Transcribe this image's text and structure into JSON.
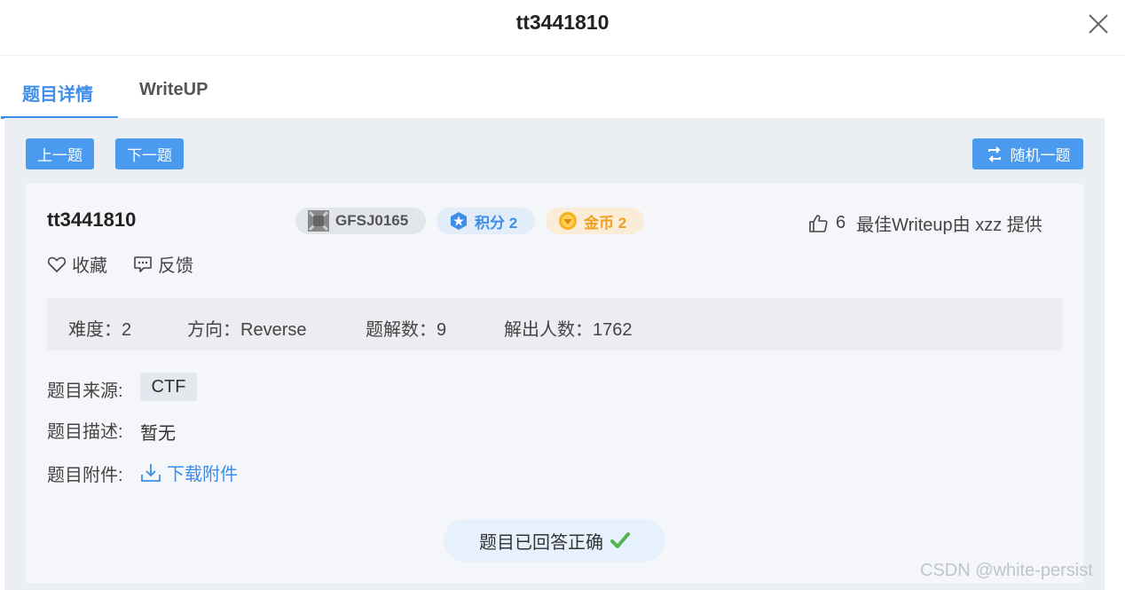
{
  "header": {
    "title": "tt3441810"
  },
  "tabs": [
    {
      "label": "题目详情"
    },
    {
      "label": "WriteUP"
    }
  ],
  "nav": {
    "prev": "上一题",
    "next": "下一题",
    "random": "随机一题"
  },
  "question": {
    "title": "tt3441810",
    "code": "GFSJ0165",
    "score": "积分 2",
    "coins": "金币 2",
    "likes": "6",
    "best_writeup": "最佳Writeup由 xzz 提供",
    "favorite": "收藏",
    "feedback": "反馈"
  },
  "stats": {
    "difficulty": "难度：2",
    "direction": "方向：Reverse",
    "solutions": "题解数：9",
    "solvers": "解出人数：1762"
  },
  "details": {
    "source_label": "题目来源:",
    "source_value": "CTF",
    "desc_label": "题目描述:",
    "desc_value": "暂无",
    "attach_label": "题目附件:",
    "attach_link": "下载附件"
  },
  "status": {
    "answered": "题目已回答正确"
  },
  "watermark": "CSDN @white-persist",
  "colors": {
    "accent": "#3d8ee8",
    "button": "#4a9bf0",
    "coin": "#f0a020",
    "success": "#52b44a"
  }
}
